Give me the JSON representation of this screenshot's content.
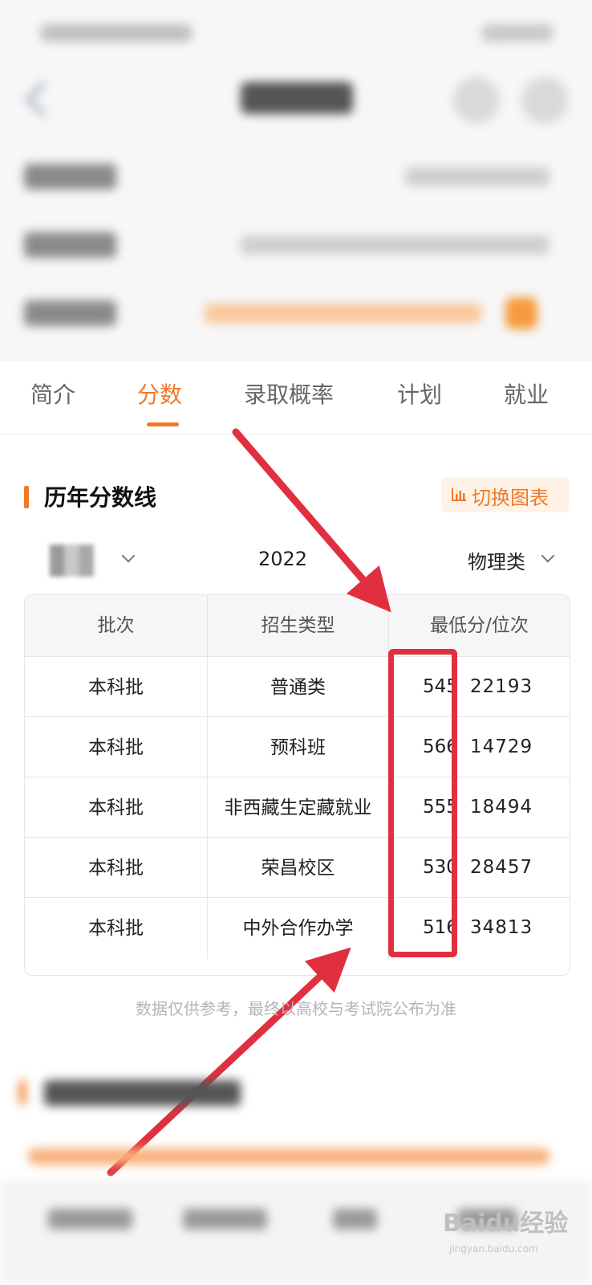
{
  "tabs": [
    {
      "label": "简介",
      "active": false
    },
    {
      "label": "分数",
      "active": true
    },
    {
      "label": "录取概率",
      "active": false
    },
    {
      "label": "计划",
      "active": false
    },
    {
      "label": "就业",
      "active": false
    }
  ],
  "section": {
    "title": "历年分数线",
    "switch_label": "切换图表",
    "switch_icon": "bar-chart-icon"
  },
  "filters": {
    "year": "2022",
    "subject": "物理类"
  },
  "table": {
    "headers": [
      "批次",
      "招生类型",
      "最低分/位次"
    ],
    "rows": [
      {
        "batch": "本科批",
        "type": "普通类",
        "score": "545",
        "rank": "22193"
      },
      {
        "batch": "本科批",
        "type": "预科班",
        "score": "566",
        "rank": "14729"
      },
      {
        "batch": "本科批",
        "type": "非西藏生定藏就业",
        "score": "555",
        "rank": "18494"
      },
      {
        "batch": "本科批",
        "type": "荣昌校区",
        "score": "530",
        "rank": "28457"
      },
      {
        "batch": "本科批",
        "type": "中外合作办学",
        "score": "516",
        "rank": "34813"
      }
    ]
  },
  "note": "数据仅供参考，最终以高校与考试院公布为准",
  "watermark": {
    "text": "Baidu经验",
    "sub": "jingyan.baidu.com"
  },
  "colors": {
    "accent": "#f07a2a",
    "annotation": "#e03040"
  }
}
